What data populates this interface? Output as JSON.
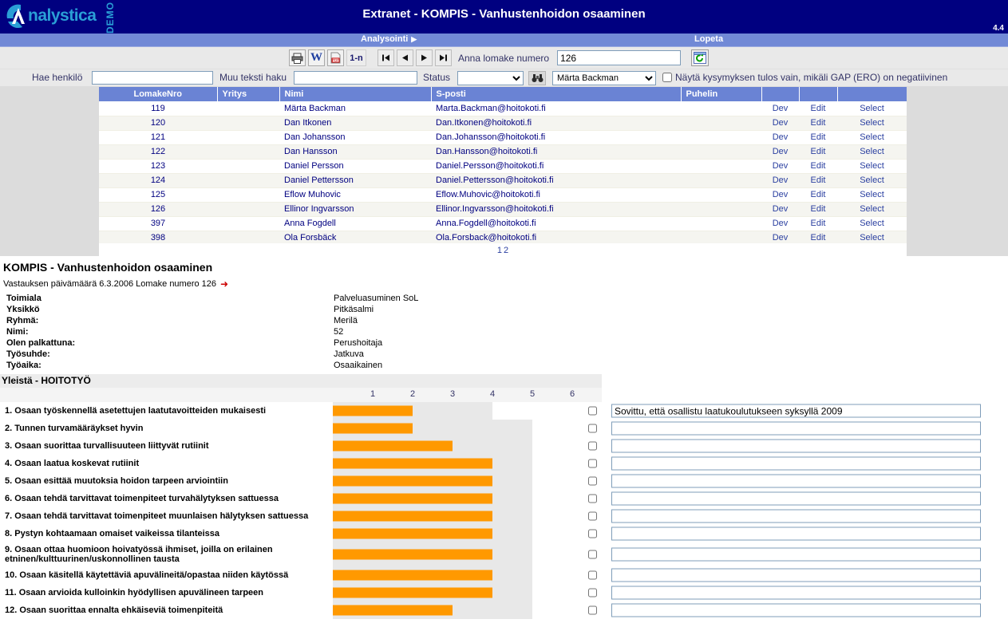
{
  "header": {
    "logo_text": "nalystica",
    "demo_label": "DEMO",
    "title": "Extranet - KOMPIS - Vanhustenhoidon osaaminen",
    "version": "4.4"
  },
  "menu": {
    "analysointi": "Analysointi",
    "analysointi_arrow": "▶",
    "lopeta": "Lopeta"
  },
  "toolbar": {
    "print_icon": "printer-icon",
    "word_icon": "word-export-icon",
    "pdf_icon": "pdf-export-icon",
    "range_label": "1-n",
    "first_icon": "⏮",
    "prev_icon": "◀",
    "next_icon": "▶",
    "last_icon": "⏭",
    "form_number_label": "Anna lomake numero",
    "form_number_value": "126",
    "refresh_icon": "refresh-icon"
  },
  "filters": {
    "person_label": "Hae henkilö",
    "person_value": "",
    "other_text_label": "Muu teksti haku",
    "other_text_value": "",
    "status_label": "Status",
    "status_value": "",
    "search_icon": "binoculars-icon",
    "selected_person": "Märta Backman",
    "gap_checkbox_label": "Näytä kysymyksen tulos vain, mikäli GAP (ERO) on negatiivinen",
    "gap_checked": false
  },
  "grid": {
    "columns": [
      "LomakeNro",
      "Yritys",
      "Nimi",
      "S-posti",
      "Puhelin",
      "",
      "",
      ""
    ],
    "action_labels": {
      "dev": "Dev",
      "edit": "Edit",
      "select": "Select"
    },
    "rows": [
      {
        "nro": "119",
        "yritys": "",
        "nimi": "Märta Backman",
        "sposti": "Marta.Backman@hoitokoti.fi",
        "puhelin": ""
      },
      {
        "nro": "120",
        "yritys": "",
        "nimi": "Dan Itkonen",
        "sposti": "Dan.Itkonen@hoitokoti.fi",
        "puhelin": ""
      },
      {
        "nro": "121",
        "yritys": "",
        "nimi": "Dan Johansson",
        "sposti": "Dan.Johansson@hoitokoti.fi",
        "puhelin": ""
      },
      {
        "nro": "122",
        "yritys": "",
        "nimi": "Dan Hansson",
        "sposti": "Dan.Hansson@hoitokoti.fi",
        "puhelin": ""
      },
      {
        "nro": "123",
        "yritys": "",
        "nimi": "Daniel Persson",
        "sposti": "Daniel.Persson@hoitokoti.fi",
        "puhelin": ""
      },
      {
        "nro": "124",
        "yritys": "",
        "nimi": "Daniel Pettersson",
        "sposti": "Daniel.Pettersson@hoitokoti.fi",
        "puhelin": ""
      },
      {
        "nro": "125",
        "yritys": "",
        "nimi": "Eflow Muhovic",
        "sposti": "Eflow.Muhovic@hoitokoti.fi",
        "puhelin": ""
      },
      {
        "nro": "126",
        "yritys": "",
        "nimi": "Ellinor Ingvarsson",
        "sposti": "Ellinor.Ingvarsson@hoitokoti.fi",
        "puhelin": ""
      },
      {
        "nro": "397",
        "yritys": "",
        "nimi": "Anna Fogdell",
        "sposti": "Anna.Fogdell@hoitokoti.fi",
        "puhelin": ""
      },
      {
        "nro": "398",
        "yritys": "",
        "nimi": "Ola Forsbäck",
        "sposti": "Ola.Forsback@hoitokoti.fi",
        "puhelin": ""
      }
    ],
    "pager": [
      "1",
      "2"
    ]
  },
  "detail": {
    "title": "KOMPIS - Vanhustenhoidon osaaminen",
    "date_line": "Vastauksen päivämäärä 6.3.2006 Lomake numero 126",
    "date_arrow": "➜",
    "meta": [
      {
        "label": "Toimiala",
        "value": "Palveluasuminen SoL"
      },
      {
        "label": "Yksikkö",
        "value": "Pitkäsalmi"
      },
      {
        "label": "Ryhmä:",
        "value": "Merilä"
      },
      {
        "label": "Nimi:",
        "value": "52"
      },
      {
        "label": "Olen palkattuna:",
        "value": "Perushoitaja"
      },
      {
        "label": "Työsuhde:",
        "value": "Jatkuva"
      },
      {
        "label": "Työaika:",
        "value": "Osaaikainen"
      }
    ]
  },
  "chart_data": {
    "type": "bar",
    "title": "Yleistä - HOITOTYÖ",
    "orientation": "horizontal",
    "xlabel": "",
    "ylabel": "",
    "xlim": [
      0,
      6
    ],
    "tick_labels": [
      "1",
      "2",
      "3",
      "4",
      "5",
      "6"
    ],
    "grid": false,
    "bar_color": "#ff9900",
    "categories": [
      "1. Osaan työskennellä asetettujen laatutavoitteiden mukaisesti",
      "2. Tunnen turvamääräykset hyvin",
      "3. Osaan suorittaa turvallisuuteen liittyvät rutiinit",
      "4. Osaan laatua koskevat rutiinit",
      "5. Osaan esittää muutoksia hoidon tarpeen arviointiin",
      "6. Osaan tehdä tarvittavat toimenpiteet turvahälytyksen sattuessa",
      "7. Osaan tehdä tarvittavat toimenpiteet muunlaisen hälytyksen sattuessa",
      "8. Pystyn kohtaamaan omaiset vaikeissa tilanteissa",
      "9. Osaan ottaa huomioon hoivatyössä ihmiset, joilla on erilainen etninen/kulttuurinen/uskonnollinen tausta",
      "10. Osaan käsitellä käytettäviä apuvälineitä/opastaa niiden käytössä",
      "11. Osaan arvioida kulloinkin hyödyllisen apuvälineen tarpeen",
      "12. Osaan suorittaa ennalta ehkäiseviä toimenpiteitä"
    ],
    "values": [
      2,
      2,
      3,
      4,
      4,
      4,
      4,
      4,
      4,
      4,
      4,
      3
    ],
    "comments": [
      "Sovittu, että osallistu laatukoulutukseen syksyllä 2009",
      "",
      "",
      "",
      "",
      "",
      "",
      "",
      "",
      "",
      "",
      ""
    ],
    "checked": [
      false,
      false,
      false,
      false,
      false,
      false,
      false,
      false,
      false,
      false,
      false,
      false
    ]
  }
}
